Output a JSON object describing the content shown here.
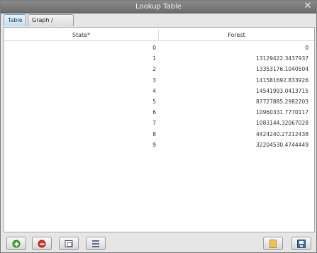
{
  "window": {
    "title": "Lookup Table"
  },
  "tabs": [
    {
      "label": "Table",
      "active": true
    },
    {
      "label": "Graph / Chart",
      "active": false
    }
  ],
  "table": {
    "columns": [
      "State*",
      "Forest"
    ],
    "rows": [
      [
        "0",
        "0"
      ],
      [
        "1",
        "13129422.3437937"
      ],
      [
        "2",
        "13353176.1040504"
      ],
      [
        "3",
        "141581692.833926"
      ],
      [
        "4",
        "14541993.0413715"
      ],
      [
        "5",
        "87727885.2982203"
      ],
      [
        "6",
        "10960331.7770117"
      ],
      [
        "7",
        "1083144.32067028"
      ],
      [
        "8",
        "4424240.27212438"
      ],
      [
        "9",
        "32204530.4744449"
      ]
    ]
  },
  "toolbar": {
    "buttons": [
      {
        "icon": "add-icon"
      },
      {
        "icon": "remove-icon"
      },
      {
        "icon": "fit-window-icon"
      },
      {
        "icon": "list-icon"
      },
      {
        "icon": "open-file-icon"
      },
      {
        "icon": "save-icon"
      }
    ]
  }
}
